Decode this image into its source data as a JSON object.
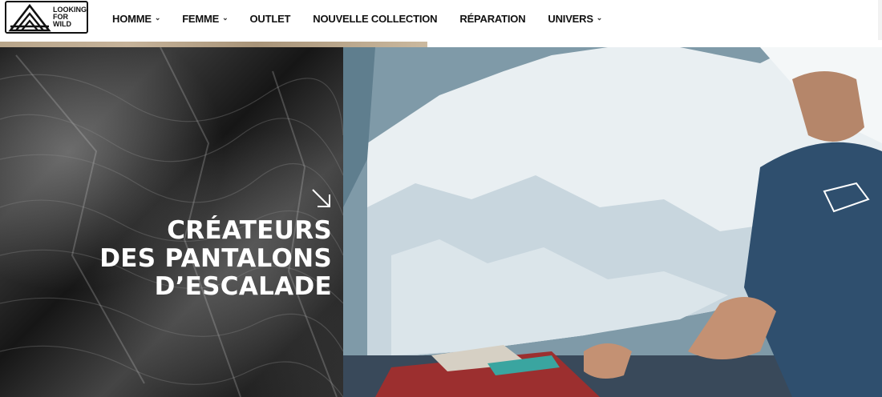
{
  "brand": {
    "logo_lines": [
      "LOOKING",
      "FOR",
      "WILD"
    ]
  },
  "nav": {
    "items": [
      {
        "label": "HOMME",
        "has_dropdown": true
      },
      {
        "label": "FEMME",
        "has_dropdown": true
      },
      {
        "label": "OUTLET",
        "has_dropdown": false
      },
      {
        "label": "NOUVELLE COLLECTION",
        "has_dropdown": false
      },
      {
        "label": "RÉPARATION",
        "has_dropdown": false
      },
      {
        "label": "UNIVERS",
        "has_dropdown": true
      }
    ],
    "dropdown_icon": "chevron-down-icon"
  },
  "hero": {
    "title_lines": [
      "CRÉATEURS",
      "DES PANTALONS",
      "D’ESCALADE"
    ],
    "link_icon": "arrow-down-right-icon"
  },
  "colors": {
    "text": "#111111",
    "hero_text": "#ffffff",
    "background": "#ffffff"
  }
}
